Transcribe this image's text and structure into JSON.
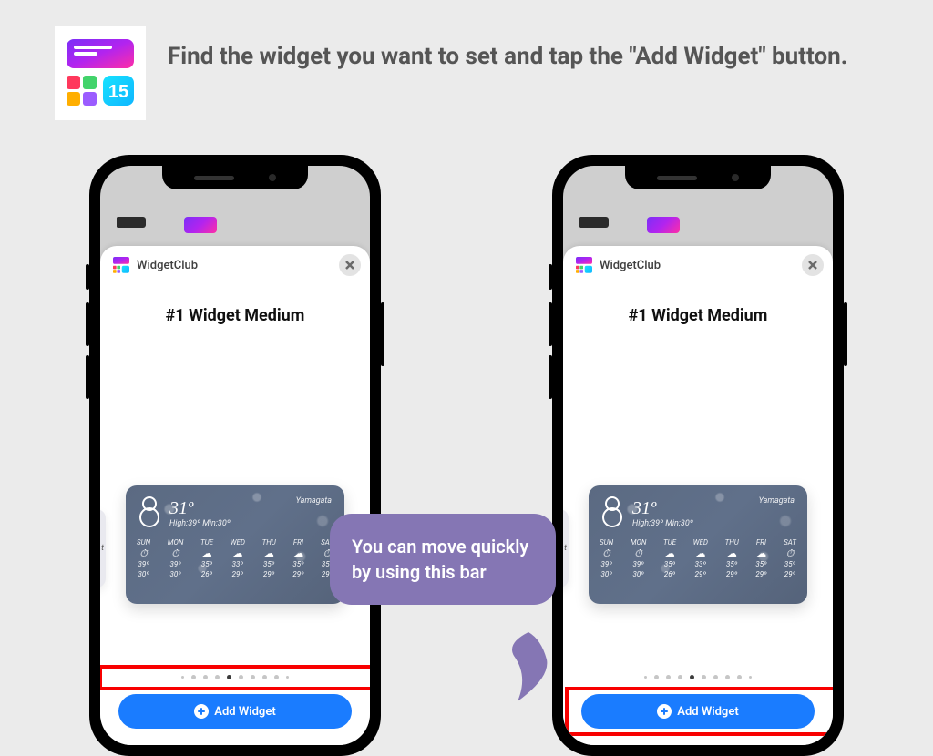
{
  "instruction": "Find the widget you want to set and tap the \"Add Widget\" button.",
  "bubble_text": "You can move quickly by using this bar",
  "phone": {
    "app_name": "WidgetClub",
    "widget_title": "#1 Widget Medium",
    "add_button_label": "Add Widget",
    "peek_label": "t",
    "weather": {
      "temp": "31º",
      "subtitle": "High:39º Min:30º",
      "location": "Yamagata",
      "days": [
        {
          "abbr": "SUN",
          "icon": "⏱",
          "hi": "39º",
          "lo": "30º"
        },
        {
          "abbr": "MON",
          "icon": "⏱",
          "hi": "39º",
          "lo": "30º"
        },
        {
          "abbr": "TUE",
          "icon": "☁",
          "hi": "35º",
          "lo": "26º"
        },
        {
          "abbr": "WED",
          "icon": "☁",
          "hi": "33º",
          "lo": "29º"
        },
        {
          "abbr": "THU",
          "icon": "☁",
          "hi": "35º",
          "lo": "29º"
        },
        {
          "abbr": "FRI",
          "icon": "☁",
          "hi": "35º",
          "lo": "29º"
        },
        {
          "abbr": "SAT",
          "icon": "⏱",
          "hi": "35º",
          "lo": "29º"
        }
      ]
    },
    "page_dots": {
      "count": 10,
      "active_index": 4
    }
  }
}
